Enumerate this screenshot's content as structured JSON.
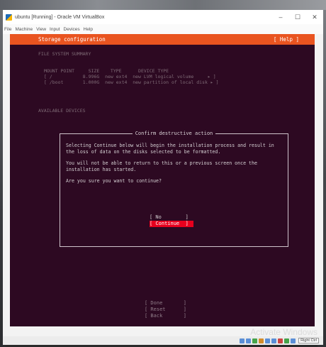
{
  "window": {
    "title": "ubuntu [Running] - Oracle VM VirtualBox",
    "controls": {
      "minimize": "–",
      "maximize": "☐",
      "close": "✕"
    }
  },
  "menu": [
    "File",
    "Machine",
    "View",
    "Input",
    "Devices",
    "Help"
  ],
  "installer": {
    "header_title": "Storage configuration",
    "help_label": "[ Help ]",
    "fs_summary_label": "FILE SYSTEM SUMMARY",
    "fs_table": {
      "header": "MOUNT POINT     SIZE    TYPE      DEVICE TYPE",
      "rows": [
        "[ /           8.996G  new ext4  new LVM logical volume     ▸ ]",
        "[ /boot       1.000G  new ext4  new partition of local disk ▸ ]"
      ]
    },
    "available_label": "AVAILABLE DEVICES",
    "bottom_buttons": [
      "[ Done       ]",
      "[ Reset      ]",
      "[ Back       ]"
    ]
  },
  "dialog": {
    "title": "Confirm destructive action",
    "paragraph1": "Selecting Continue below will begin the installation process and result in the loss of data on the disks selected to be formatted.",
    "paragraph2": "You will not be able to return to this or a previous screen once the installation has started.",
    "question": "Are you sure you want to continue?",
    "no_label": "[ No        ]",
    "continue_label": "[ Continue  ]"
  },
  "watermark": "Activate Windows",
  "statusbar": {
    "host_key": "Right Ctrl"
  },
  "colors": {
    "ubuntu_orange": "#e95420",
    "console_bg": "#2d0922",
    "selected_button": "#e7001e"
  }
}
